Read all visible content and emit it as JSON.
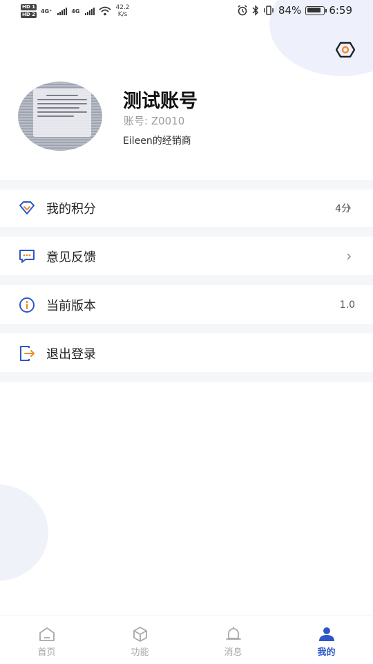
{
  "status_bar": {
    "hd1": "HD 1",
    "hd2": "HD 2",
    "sim1": "4G⁺",
    "sim2": "4G",
    "speed_value": "42.2",
    "speed_unit": "K/s",
    "battery": "84%",
    "time": "6:59"
  },
  "profile": {
    "name": "测试账号",
    "account": "账号: Z0010",
    "dealer": "Eileen的经销商"
  },
  "menu": {
    "points": {
      "label": "我的积分",
      "value": "4分"
    },
    "feedback": {
      "label": "意见反馈"
    },
    "version": {
      "label": "当前版本",
      "value": "1.0"
    },
    "logout": {
      "label": "退出登录"
    }
  },
  "tabbar": {
    "home": "首页",
    "features": "功能",
    "messages": "消息",
    "mine": "我的"
  },
  "colors": {
    "accent": "#2e56c9",
    "logout_accent": "#f08a2a"
  }
}
